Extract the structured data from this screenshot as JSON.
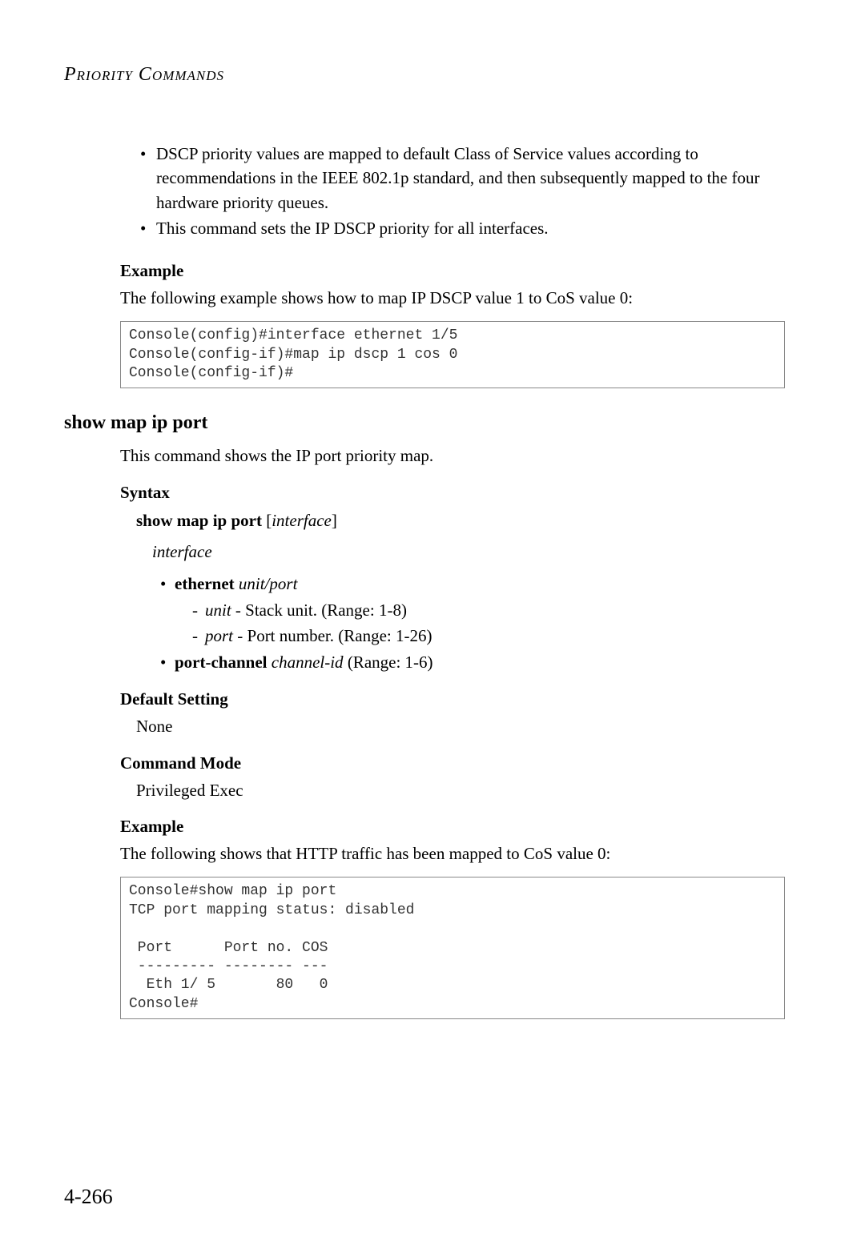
{
  "header": "Priority Commands",
  "intro_bullets": [
    "DSCP priority values are mapped to default Class of Service values according to recommendations in the IEEE 802.1p standard, and then subsequently mapped to the four hardware priority queues.",
    "This command sets the IP DSCP priority for all interfaces."
  ],
  "example1": {
    "heading": "Example",
    "text": "The following example shows how to map IP DSCP value 1 to CoS value 0:",
    "code": "Console(config)#interface ethernet 1/5\nConsole(config-if)#map ip dscp 1 cos 0\nConsole(config-if)#"
  },
  "command": {
    "title": "show map ip port",
    "desc": "This command shows the IP port priority map.",
    "syntax_heading": "Syntax",
    "syntax_cmd_bold": "show map ip port",
    "syntax_cmd_arg": "interface",
    "interface_label": "interface",
    "ethernet_bold": "ethernet",
    "ethernet_args": "unit/port",
    "unit_label": "unit",
    "unit_desc": " - Stack unit. (Range: 1-8)",
    "port_label": "port",
    "port_desc": " - Port number. (Range: 1-26)",
    "portchannel_bold": "port-channel",
    "portchannel_arg": "channel-id",
    "portchannel_range": " (Range: 1-6)",
    "default_heading": "Default Setting",
    "default_value": "None",
    "mode_heading": "Command Mode",
    "mode_value": "Privileged Exec",
    "example_heading": "Example",
    "example_text": "The following shows that HTTP traffic has been mapped to CoS value 0:",
    "example_code": "Console#show map ip port\nTCP port mapping status: disabled\n\n Port      Port no. COS\n --------- -------- ---\n  Eth 1/ 5       80   0\nConsole#"
  },
  "page_number": "4-266"
}
